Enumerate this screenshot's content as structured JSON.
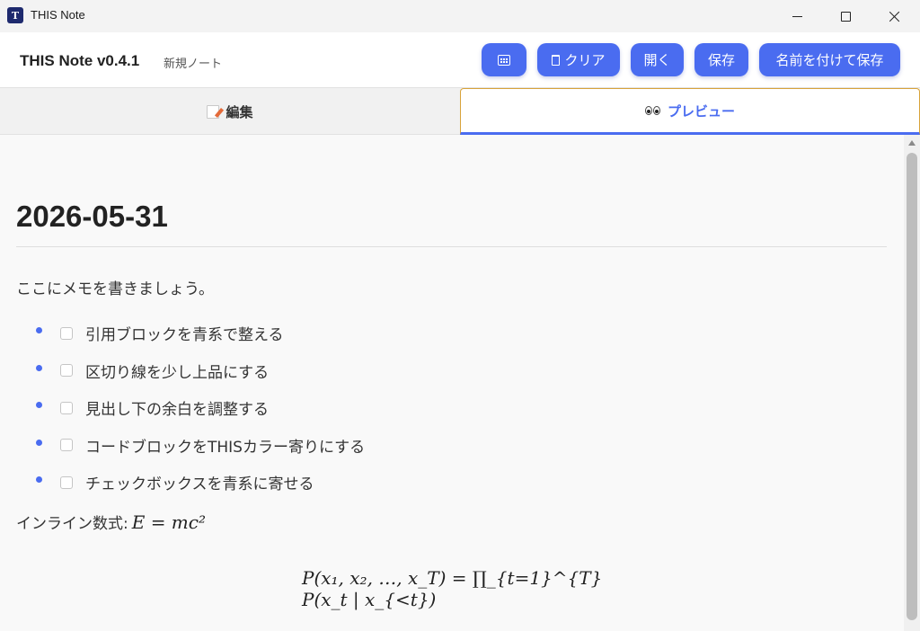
{
  "window": {
    "title": "THIS Note",
    "icon_glyph": "T"
  },
  "header": {
    "app_name": "THIS Note v0.4.1",
    "doc_name": "新規ノート",
    "buttons": {
      "calendar": "",
      "clear": "クリア",
      "open": "開く",
      "save": "保存",
      "save_as": "名前を付けて保存"
    }
  },
  "tabs": {
    "edit": "編集",
    "preview": "プレビュー",
    "active": "preview"
  },
  "preview": {
    "heading": "2026-05-31",
    "paragraph": "ここにメモを書きましょう。",
    "tasks": [
      {
        "label": "引用ブロックを青系で整える",
        "checked": false
      },
      {
        "label": "区切り線を少し上品にする",
        "checked": false
      },
      {
        "label": "見出し下の余白を調整する",
        "checked": false
      },
      {
        "label": "コードブロックをTHISカラー寄りにする",
        "checked": false
      },
      {
        "label": "チェックボックスを青系に寄せる",
        "checked": false
      }
    ],
    "inline_math_label": "インライン数式:",
    "inline_math": "E = mc²",
    "display_math": "P(x₁, x₂, …, x_T) = ∏_{t=1}^{T} P(x_t | x_{<t})"
  },
  "colors": {
    "accent": "#4a6cf0",
    "tab_active_border": "#d8a33a"
  }
}
